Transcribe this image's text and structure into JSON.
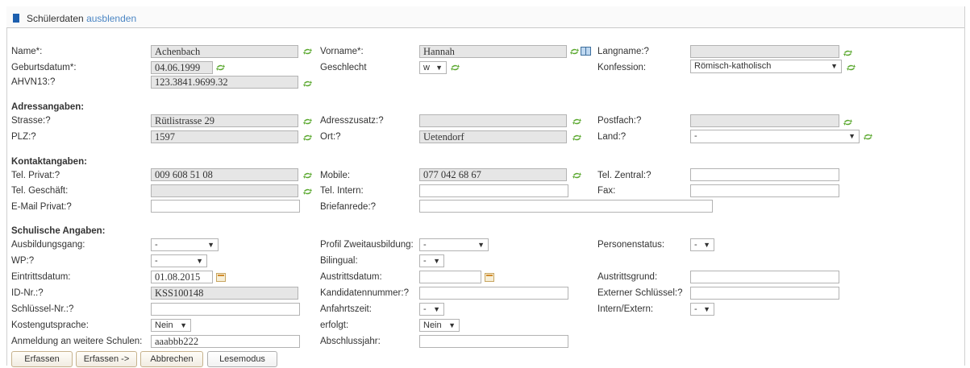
{
  "header": {
    "title": "Schülerdaten",
    "toggle": "ausblenden"
  },
  "labels": {
    "name": "Name*:",
    "vorname": "Vorname*:",
    "langname": "Langname:",
    "q": "?",
    "geburtsdatum": "Geburtsdatum*:",
    "geschlecht": "Geschlecht",
    "konfession": "Konfession:",
    "ahvn13": "AHVN13:",
    "strasse": "Strasse:",
    "adresszusatz": "Adresszusatz:",
    "postfach": "Postfach:",
    "plz": "PLZ:",
    "ort": "Ort:",
    "land": "Land:",
    "telprivat": "Tel. Privat:",
    "mobile": "Mobile:",
    "telzentral": "Tel. Zentral:",
    "telgeschaeft": "Tel. Geschäft:",
    "telintern": "Tel. Intern:",
    "fax": "Fax:",
    "emailprivat": "E-Mail Privat:",
    "briefanrede": "Briefanrede:",
    "ausbildungsgang": "Ausbildungsgang:",
    "profil": "Profil Zweitausbildung:",
    "personenstatus": "Personenstatus:",
    "wp": "WP:",
    "bilingual": "Bilingual:",
    "eintrittsdatum": "Eintrittsdatum:",
    "austrittsdatum": "Austrittsdatum:",
    "austrittsgrund": "Austrittsgrund:",
    "idnr": "ID-Nr.:",
    "kandidatennummer": "Kandidatennummer:",
    "externerschluessel": "Externer Schlüssel:",
    "schluesselnr": "Schlüssel-Nr.:",
    "anfahrtszeit": "Anfahrtszeit:",
    "internextern": "Intern/Extern:",
    "kostengutsprache": "Kostengutsprache:",
    "erfolgt": "erfolgt:",
    "anmeldung": "Anmeldung an weitere Schulen:",
    "abschlussjahr": "Abschlussjahr:"
  },
  "sections": {
    "adresse": "Adressangaben:",
    "kontakt": "Kontaktangaben:",
    "schule": "Schulische Angaben:"
  },
  "values": {
    "name": "Achenbach",
    "vorname": "Hannah",
    "langname": "",
    "geburtsdatum": "04.06.1999",
    "geschlecht": "w",
    "konfession": "Römisch-katholisch",
    "ahvn13": "123.3841.9699.32",
    "strasse": "Rütlistrasse 29",
    "adresszusatz": "",
    "postfach": "",
    "plz": "1597",
    "ort": "Uetendorf",
    "land": "-",
    "telprivat": "009 608 51 08",
    "mobile": "077 042 68 67",
    "telzentral": "",
    "telgeschaeft": "",
    "telintern": "",
    "fax": "",
    "emailprivat": "",
    "briefanrede": "",
    "ausbildungsgang": "-",
    "profil": "-",
    "personenstatus": "-",
    "wp": "-",
    "bilingual": "-",
    "eintrittsdatum": "01.08.2015",
    "austrittsdatum": "",
    "austrittsgrund": "",
    "idnr": "KSS100148",
    "kandidatennummer": "",
    "externerschluessel": "",
    "schluesselnr": "",
    "anfahrtszeit": "-",
    "internextern": "-",
    "kostengutsprache": "Nein",
    "erfolgt": "Nein",
    "anmeldung": "aaabbb222",
    "abschlussjahr": ""
  },
  "buttons": {
    "erfassen": "Erfassen",
    "erfassen_next": "Erfassen ->",
    "abbrechen": "Abbrechen",
    "lesemodus": "Lesemodus"
  },
  "colors": {
    "accent": "#1d5fae",
    "link": "#4b86c4",
    "sync": "#5aa82e",
    "readonly": "#e6e6e6"
  }
}
